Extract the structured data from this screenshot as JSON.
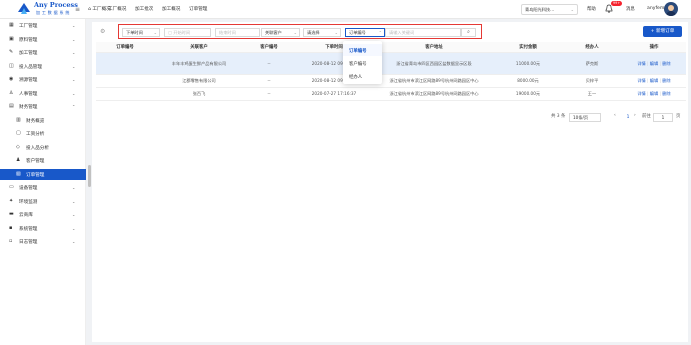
{
  "app": {
    "title": "Any Process",
    "subtitle": "加 工 数 据 系 统"
  },
  "topnav": [
    "工厂概况",
    "工厂概况",
    "加工批次",
    "加工概况",
    "订单管理"
  ],
  "header": {
    "company": "青岛阳光科技...",
    "help": "帮助",
    "notif_count": "99+",
    "messages": "消息",
    "username": "anyfem"
  },
  "sidebar": {
    "items": [
      {
        "label": "工厂管理",
        "icon": "grid-icon",
        "chevron": "⌄",
        "sub": false
      },
      {
        "label": "原料管理",
        "icon": "box-icon",
        "chevron": "⌄",
        "sub": false
      },
      {
        "label": "加工管理",
        "icon": "wrench-icon",
        "chevron": "⌄",
        "sub": false
      },
      {
        "label": "投入品管理",
        "icon": "flask-icon",
        "chevron": "⌄",
        "sub": false
      },
      {
        "label": "溯源管理",
        "icon": "scan-icon",
        "chevron": "⌄",
        "sub": false
      },
      {
        "label": "人事管理",
        "icon": "person-icon",
        "chevron": "⌄",
        "sub": false
      },
      {
        "label": "财务管理",
        "icon": "finance-icon",
        "chevron": "⌃",
        "sub": false
      },
      {
        "label": "财务概览",
        "icon": "chart-icon",
        "chevron": "",
        "sub": true
      },
      {
        "label": "工资分析",
        "icon": "doc-icon",
        "chevron": "",
        "sub": true
      },
      {
        "label": "投入品分析",
        "icon": "diamond-icon",
        "chevron": "",
        "sub": true
      },
      {
        "label": "客户管理",
        "icon": "people-icon",
        "chevron": "",
        "sub": true
      },
      {
        "label": "订单管理",
        "icon": "order-icon",
        "chevron": "",
        "sub": true
      },
      {
        "label": "设备管理",
        "icon": "device-icon",
        "chevron": "⌄",
        "sub": false
      },
      {
        "label": "环境监测",
        "icon": "env-icon",
        "chevron": "⌄",
        "sub": false
      },
      {
        "label": "云商库",
        "icon": "shop-icon",
        "chevron": "⌄",
        "sub": false
      },
      {
        "label": "系统管理",
        "icon": "settings-icon",
        "chevron": "⌄",
        "sub": false
      },
      {
        "label": "日志管理",
        "icon": "log-icon",
        "chevron": "⌄",
        "sub": false
      }
    ],
    "active_index": 11
  },
  "filters": {
    "order_time": "下单时间",
    "start_placeholder": "开始时间",
    "end_placeholder": "结束时间",
    "customer": "关联客户",
    "status": "请选择",
    "search_field": "订单编号",
    "search_placeholder": "请输入关键词"
  },
  "add_button": "+ 新增订单",
  "dropdown": {
    "options": [
      "订单编号",
      "客户编号",
      "经办人"
    ],
    "selected_index": 0
  },
  "table": {
    "headers": [
      "订单编号",
      "关联客户",
      "客户编号",
      "下单时间",
      "客户地址",
      "实付金额",
      "经办人",
      "操作"
    ],
    "rows": [
      {
        "cells": [
          "",
          "丰年丰鸡蛋生鲜产品有限公司",
          "--",
          "2020-08-12 09:00:00",
          "浙江省青岛市四区西园区盐数据显示区段",
          "11000.00元",
          "萨克斯"
        ],
        "highlight": true
      },
      {
        "cells": [
          "",
          "江郡零售有限公司",
          "--",
          "2020-08-12 09:00:00",
          "浙江省杭州市滨江区网路89号杭州网路园区中心",
          "8000.00元",
          "贝梓平"
        ],
        "highlight": false
      },
      {
        "cells": [
          "",
          "张百飞",
          "--",
          "2020-07-27 17:16:37",
          "浙江省杭州市滨江区网路89号杭州网路园区中心",
          "19000.00元",
          "王一"
        ],
        "highlight": false
      }
    ],
    "actions": [
      "详情",
      "编辑",
      "删除"
    ]
  },
  "pagination": {
    "total": "共 3 条",
    "page_size": "10条/页",
    "current": "1",
    "goto_label": "前往",
    "goto_value": "1",
    "page_unit": "页"
  }
}
